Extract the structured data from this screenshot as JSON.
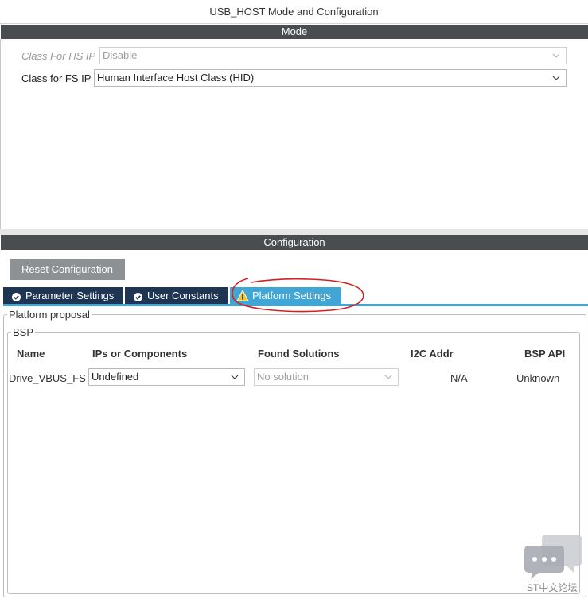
{
  "window": {
    "title": "USB_HOST Mode and Configuration"
  },
  "mode": {
    "header": "Mode",
    "fields": [
      {
        "label": "Class For HS IP",
        "value": "Disable",
        "disabled": true
      },
      {
        "label": "Class for FS IP",
        "value": "Human Interface Host Class (HID)",
        "disabled": false
      }
    ]
  },
  "configuration": {
    "header": "Configuration",
    "reset_label": "Reset Configuration",
    "tabs": [
      {
        "label": "Parameter Settings",
        "icon": "check-circle-icon",
        "active": false
      },
      {
        "label": "User Constants",
        "icon": "check-circle-icon",
        "active": false
      },
      {
        "label": "Platform Settings",
        "icon": "warning-icon",
        "active": true
      }
    ]
  },
  "platform": {
    "legend": "Platform proposal",
    "bsp_legend": "BSP",
    "columns": [
      "Name",
      "IPs or Components",
      "Found Solutions",
      "I2C Addr",
      "BSP API"
    ],
    "rows": [
      {
        "name": "Drive_VBUS_FS",
        "component": "Undefined",
        "solution": "No solution",
        "i2c": "N/A",
        "api": "Unknown"
      }
    ]
  },
  "watermark": {
    "text": "ST中文论坛"
  },
  "colors": {
    "header_bar": "#4a4d50",
    "tab_dark": "#1e3553",
    "tab_active": "#3fa6d6",
    "annotation": "#d42020",
    "warning": "#f2c230"
  }
}
